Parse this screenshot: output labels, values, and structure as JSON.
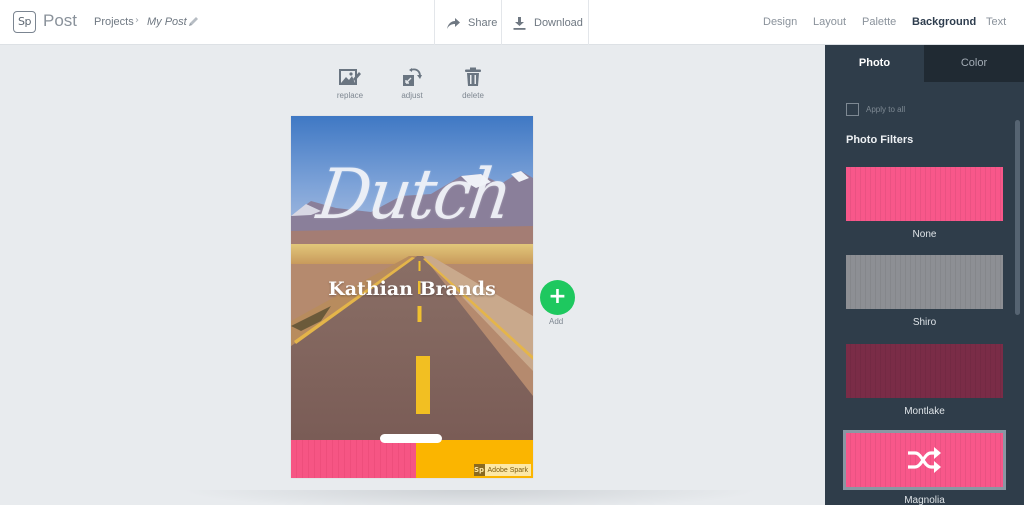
{
  "app": {
    "logo_text": "Sp",
    "name": "Post"
  },
  "breadcrumb": {
    "projects": "Projects",
    "separator": "›",
    "current": "My Post"
  },
  "header_actions": {
    "share": "Share",
    "download": "Download"
  },
  "nav_tabs": [
    {
      "label": "Design",
      "active": false
    },
    {
      "label": "Layout",
      "active": false
    },
    {
      "label": "Palette",
      "active": false
    },
    {
      "label": "Background",
      "active": true
    },
    {
      "label": "Text",
      "active": false
    }
  ],
  "photo_tools": {
    "replace": "replace",
    "adjust": "adjust",
    "delete": "delete"
  },
  "post": {
    "title": "Dutch",
    "subtitle": "Kathian Brands",
    "watermark_logo": "Sp",
    "watermark_text": "Adobe Spark",
    "band_colors": [
      "#f65584",
      "#fbb500"
    ]
  },
  "add_button": {
    "icon": "+",
    "label": "Add"
  },
  "panel": {
    "tabs": [
      {
        "label": "Photo",
        "active": true
      },
      {
        "label": "Color",
        "active": false
      }
    ],
    "apply_to_all": {
      "label": "Apply to all",
      "checked": false
    },
    "section_title": "Photo Filters",
    "filters": [
      {
        "name": "None",
        "color": "#f8578a",
        "selected": false
      },
      {
        "name": "Shiro",
        "color": "#8d8f94",
        "selected": false
      },
      {
        "name": "Montlake",
        "color": "#7a2c47",
        "selected": false
      },
      {
        "name": "Magnolia",
        "color": "#f8578a",
        "selected": true
      }
    ]
  }
}
